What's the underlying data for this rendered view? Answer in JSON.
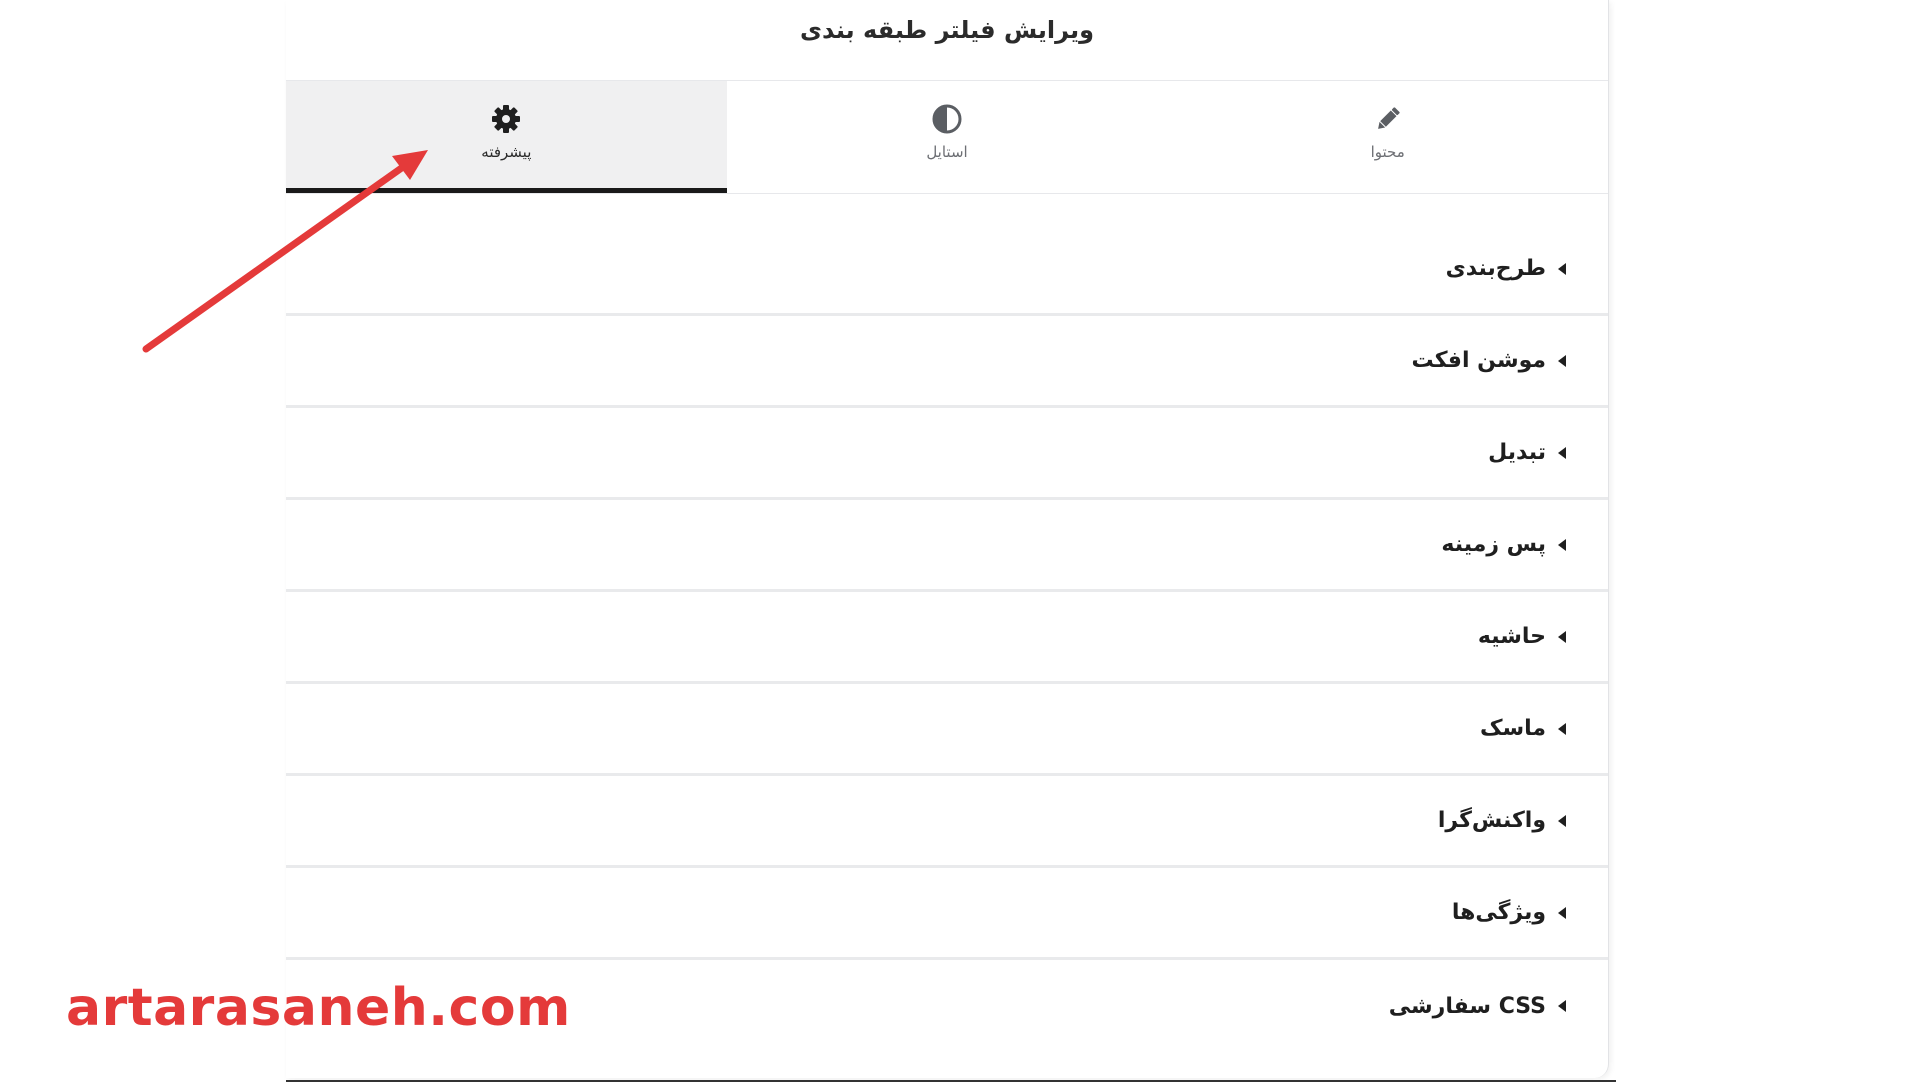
{
  "dialog": {
    "title": "ویرایش فیلتر طبقه بندی"
  },
  "tabs": [
    {
      "label": "پیشرفته",
      "icon": "gear-icon",
      "active": true
    },
    {
      "label": "استایل",
      "icon": "contrast-icon",
      "active": false
    },
    {
      "label": "محتوا",
      "icon": "pencil-icon",
      "active": false
    }
  ],
  "sections": [
    {
      "label": "طرح‌بندی",
      "icon": "caret-left-icon"
    },
    {
      "label": "موشن افکت",
      "icon": "caret-left-icon"
    },
    {
      "label": "تبدیل",
      "icon": "caret-left-icon"
    },
    {
      "label": "پس زمینه",
      "icon": "caret-left-icon"
    },
    {
      "label": "حاشیه",
      "icon": "caret-left-icon"
    },
    {
      "label": "ماسک",
      "icon": "caret-left-icon"
    },
    {
      "label": "واکنش‌گرا",
      "icon": "caret-left-icon"
    },
    {
      "label": "ویژگی‌ها",
      "icon": "caret-left-icon"
    },
    {
      "label": "CSS سفارشی",
      "icon": "caret-left-icon"
    }
  ],
  "watermark": {
    "text": "artarasaneh.com"
  },
  "colors": {
    "accent_red": "#e43a3a",
    "active_tab_bg": "#f0f0f1",
    "active_tab_underline": "#1a1a1a",
    "divider": "#e9eaec"
  }
}
